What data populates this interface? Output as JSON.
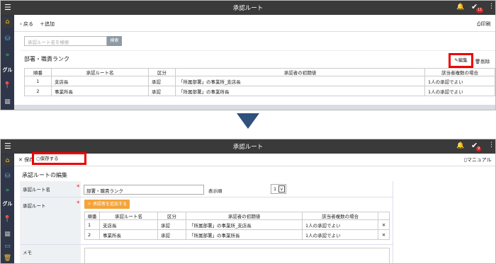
{
  "top": {
    "header_title": "承認ルート",
    "badge_count": "11",
    "toolbar": {
      "back": "戻る",
      "add": "追加",
      "print": "印刷"
    },
    "search": {
      "placeholder": "承認ルート名を検索",
      "button": "検索"
    },
    "section_title": "部署・職責ランク",
    "edit_label": "編集",
    "delete_label": "削除",
    "side_label": "グル",
    "table": {
      "headers": [
        "順番",
        "承認ルート名",
        "区分",
        "承認者の初期値",
        "該当者複数の場合"
      ],
      "rows": [
        [
          "1",
          "支店長",
          "承認",
          "「所属部署」の事業所_支店長",
          "1人の承認でよい"
        ],
        [
          "2",
          "事業所長",
          "承認",
          "「所属部署」の事業所長",
          "1人の承認でよい"
        ]
      ]
    }
  },
  "bottom": {
    "header_title": "承認ルート",
    "badge_count": "9",
    "toolbar": {
      "discard": "保存せず戻る",
      "save": "保存する",
      "manual": "マニュアル"
    },
    "section_title": "承認ルートの編集",
    "side_label": "グル",
    "form": {
      "route_name_label": "承認ルート名",
      "route_name_value": "部署・職責ランク",
      "display_order_label": "表示順",
      "display_order_value": "1",
      "route_label": "承認ルート",
      "add_approver": "承認者を追加する",
      "memo_label": "メモ"
    },
    "table": {
      "headers": [
        "順番",
        "承認ルート名",
        "区分",
        "承認者の初期値",
        "該当者複数の場合"
      ],
      "rows": [
        [
          "1",
          "支店長",
          "承認",
          "「所属部署」の事業所_支店長",
          "1人の承認でよい"
        ],
        [
          "2",
          "事業所長",
          "承認",
          "「所属部署」の事業所長",
          "1人の承認でよい"
        ]
      ]
    }
  },
  "colors": {
    "header": "#3a3a3a",
    "sidebar": "#30364a",
    "highlight": "#e00000",
    "accent": "#f4a43a",
    "arrow": "#30507e"
  }
}
